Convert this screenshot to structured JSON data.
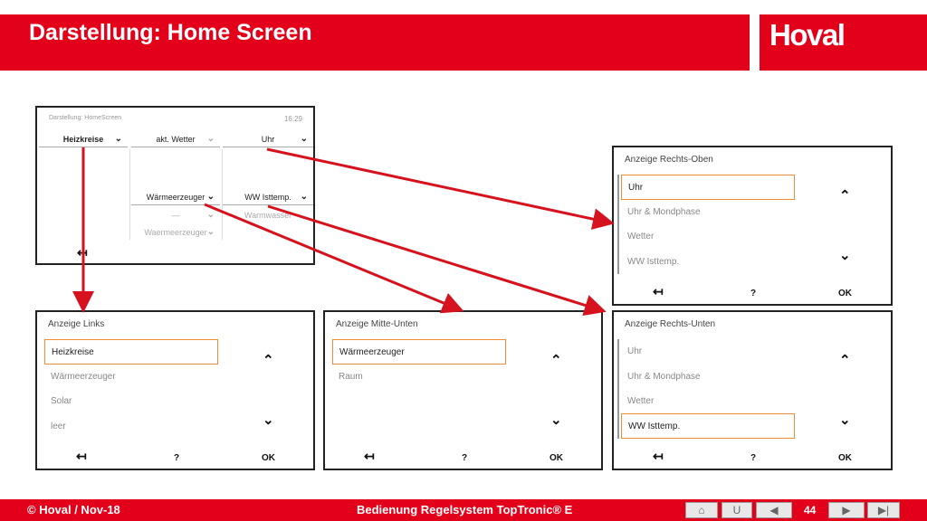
{
  "header": {
    "title": "Darstellung: Home Screen",
    "logo": "Hoval"
  },
  "home_screen": {
    "title": "Darstellung: HomeScreen",
    "time": "16:29",
    "dropdowns": {
      "left": "Heizkreise",
      "middle": "akt. Wetter",
      "right": "Uhr",
      "middle_low": "Wärmeerzeuger",
      "right_low": "WW Isttemp.",
      "dim1": "—",
      "dim2": "Warmwasser",
      "dim3": "Waermeerzeuger"
    },
    "back": "↤"
  },
  "panels": {
    "rechts_oben": {
      "title": "Anzeige Rechts-Oben",
      "items": [
        "Uhr",
        "Uhr & Mondphase",
        "Wetter",
        "WW Isttemp."
      ]
    },
    "links": {
      "title": "Anzeige Links",
      "items": [
        "Heizkreise",
        "Wärmeerzeuger",
        "Solar",
        "leer"
      ]
    },
    "mitte_unten": {
      "title": "Anzeige Mitte-Unten",
      "items": [
        "Wärmeerzeuger",
        "Raum"
      ]
    },
    "rechts_unten": {
      "title": "Anzeige Rechts-Unten",
      "items": [
        "Uhr",
        "Uhr & Mondphase",
        "Wetter",
        "WW Isttemp."
      ]
    }
  },
  "controls": {
    "up": "⌃",
    "down": "⌄",
    "back": "↤",
    "help": "?",
    "ok": "OK"
  },
  "footer": {
    "left": "© Hoval / Nov-18",
    "center": "Bedienung Regelsystem TopTronic® E",
    "page": "44",
    "nav": [
      "⌂",
      "U",
      "◀",
      "▶",
      "▶|"
    ]
  },
  "colors": {
    "brand_red": "#e2001a",
    "selection": "#f08c32",
    "arrow": "#d5121e"
  }
}
